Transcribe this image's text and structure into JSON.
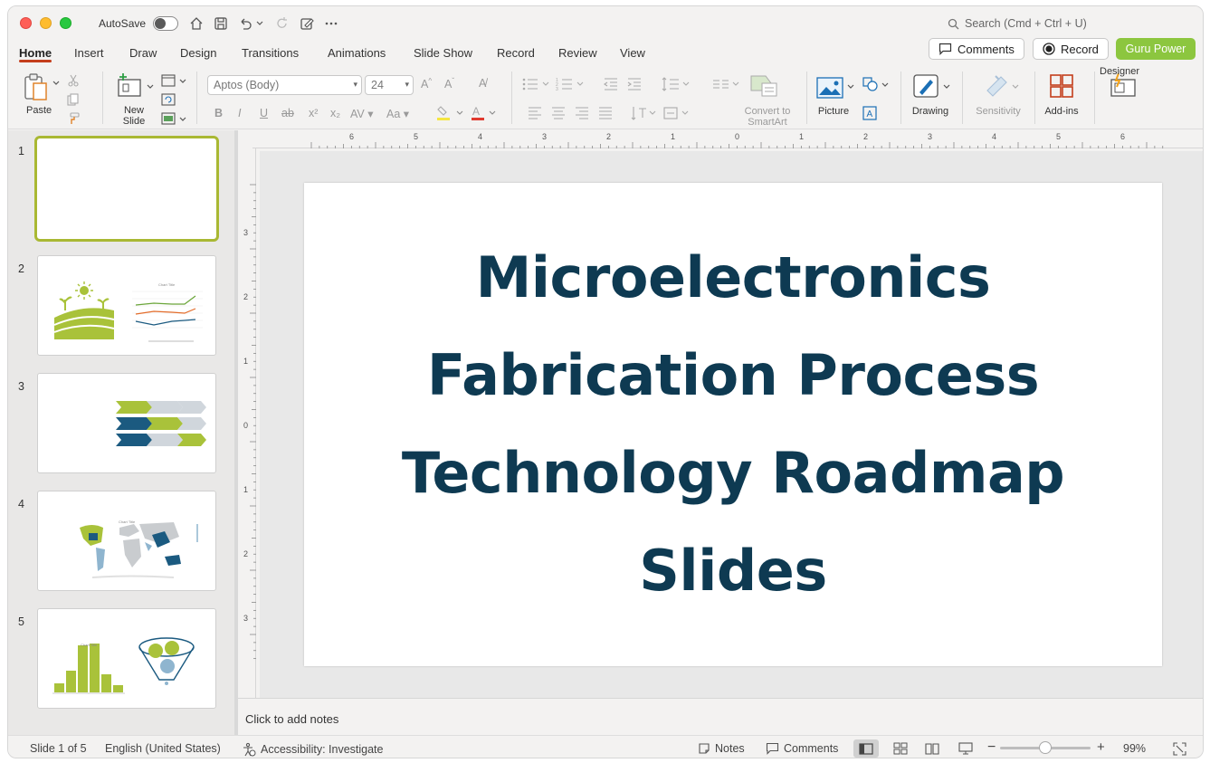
{
  "titlebar": {
    "autosave_label": "AutoSave",
    "search_placeholder": "Search (Cmd + Ctrl + U)"
  },
  "menu": {
    "tabs": [
      "Home",
      "Insert",
      "Draw",
      "Design",
      "Transitions",
      "Animations",
      "Slide Show",
      "Record",
      "Review",
      "View"
    ],
    "active_tab": "Home",
    "comments_label": "Comments",
    "record_label": "Record",
    "guru_label": "Guru Power"
  },
  "ribbon": {
    "paste_label": "Paste",
    "new_slide_label_1": "New",
    "new_slide_label_2": "Slide",
    "font_name": "Aptos (Body)",
    "font_size": "24",
    "convert_label_1": "Convert to",
    "convert_label_2": "SmartArt",
    "picture_label": "Picture",
    "drawing_label": "Drawing",
    "sensitivity_label": "Sensitivity",
    "addins_label": "Add-ins",
    "designer_label": "Designer"
  },
  "slides_panel": {
    "numbers": [
      "1",
      "2",
      "3",
      "4",
      "5"
    ],
    "thumb2_chart_title": "Chart Title",
    "thumb4_chart_title": "Chart Title",
    "thumb5_chart_title": "Chart Title"
  },
  "slide": {
    "title_lines": [
      "Microelectronics",
      "Fabrication Process",
      "Technology Roadmap",
      "Slides"
    ]
  },
  "ruler": {
    "top_labels": [
      "6",
      "5",
      "4",
      "3",
      "2",
      "1",
      "0",
      "1",
      "2",
      "3",
      "4",
      "5",
      "6"
    ],
    "left_labels": [
      "3",
      "2",
      "1",
      "0",
      "1",
      "2",
      "3"
    ]
  },
  "notes": {
    "placeholder": "Click to add notes"
  },
  "status": {
    "slide_info": "Slide 1 of 5",
    "language": "English (United States)",
    "accessibility": "Accessibility: Investigate",
    "notes_label": "Notes",
    "comments_label": "Comments",
    "zoom": "99%"
  },
  "colors": {
    "brand_green": "#8cc63f",
    "thumb_green": "#a9c23a",
    "thumb_navy": "#1b5a80",
    "title_navy": "#0e3a52",
    "accent_red": "#c43e1c"
  }
}
